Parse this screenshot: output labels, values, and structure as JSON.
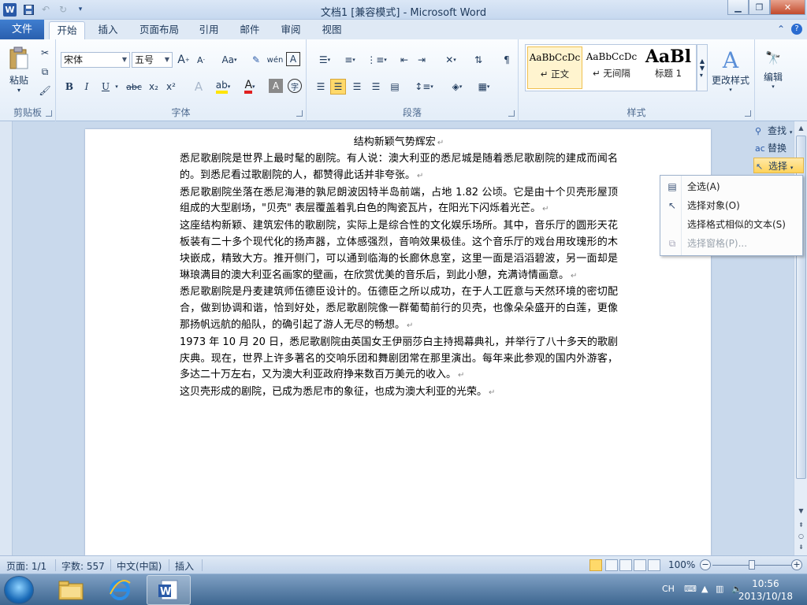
{
  "window": {
    "title": "文档1 [兼容模式] - Microsoft Word",
    "app_logo": "W",
    "controls": [
      "minimize-icon",
      "restore-icon",
      "close-icon"
    ]
  },
  "ribbon_tabs": [
    "文件",
    "开始",
    "插入",
    "页面布局",
    "引用",
    "邮件",
    "审阅",
    "视图"
  ],
  "clipboard": {
    "paste_label": "粘贴",
    "group_label": "剪贴板"
  },
  "font": {
    "name": "宋体",
    "size": "五号",
    "group_label": "字体",
    "bold": "B",
    "italic": "I",
    "underline": "U",
    "strike": "abc",
    "subscript": "x₂",
    "superscript": "x²",
    "change_case": "Aa",
    "grow": "A",
    "shrink": "A",
    "char_border": "A",
    "enclose": "字"
  },
  "paragraph": {
    "group_label": "段落"
  },
  "styles": {
    "group_label": "样式",
    "items": [
      {
        "sample": "AaBbCcDc",
        "name": "↵ 正文"
      },
      {
        "sample": "AaBbCcDc",
        "name": "↵ 无间隔"
      },
      {
        "sample": "AaBl",
        "name": "标题 1"
      }
    ],
    "change_styles_label": "更改样式"
  },
  "editing": {
    "group_label": "编辑",
    "find_label": "查找",
    "replace_label": "替换",
    "select_label": "选择"
  },
  "select_menu": {
    "items": [
      {
        "label": "全选(A)",
        "disabled": false
      },
      {
        "label": "选择对象(O)",
        "disabled": false
      },
      {
        "label": "选择格式相似的文本(S)",
        "disabled": false
      },
      {
        "label": "选择窗格(P)...",
        "disabled": true
      }
    ]
  },
  "document": {
    "title": "结构新颖气势辉宏",
    "paragraphs": [
      "悉尼歌剧院是世界上最时髦的剧院。有人说：澳大利亚的悉尼城是随着悉尼歌剧院的建成而闻名的。到悉尼看过歌剧院的人，都赞得此话并非夸张。",
      "悉尼歌剧院坐落在悉尼海港的孰尼朗波因特半岛前端，占地 1.82 公顷。它是由十个贝壳形屋顶组成的大型剧场，\"贝壳\" 表层覆盖着乳白色的陶瓷瓦片，在阳光下闪烁着光芒。",
      "这座结构新颖、建筑宏伟的歌剧院，实际上是综合性的文化娱乐场所。其中，音乐厅的圆形天花板装有二十多个现代化的扬声器，立体感强烈，音响效果极佳。这个音乐厅的戏台用玫瑰形的木块嵌成，精致大方。推开侧门，可以通到临海的长廊休息室，这里一面是滔滔碧波，另一面却是琳琅满目的澳大利亚名画家的壁画，在欣赏优美的音乐后，到此小憩，充满诗情画意。",
      "悉尼歌剧院是丹麦建筑师伍德臣设计的。伍德臣之所以成功，在于人工匠意与天然环境的密切配合，做到协调和谐，恰到好处，悉尼歌剧院像一群葡萄前行的贝壳，也像朵朵盛开的白莲，更像那扬帆远航的船队，的确引起了游人无尽的畅想。",
      "1973 年 10 月 20 日，悉尼歌剧院由英国女王伊丽莎白主持揭幕典礼，并举行了八十多天的歌剧庆典。现在，世界上许多著名的交响乐团和舞剧团常在那里演出。每年来此参观的国内外游客，多达二十万左右，又为澳大利亚政府挣来数百万美元的收入。",
      "这贝壳形成的剧院，已成为悉尼市的象征，也成为澳大利亚的光荣。"
    ],
    "para_mark": "↵"
  },
  "statusbar": {
    "page": "页面: 1/1",
    "words": "字数: 557",
    "language": "中文(中国)",
    "mode": "插入",
    "zoom": "100%",
    "zoom_fraction": 0.5
  },
  "taskbar": {
    "time": "10:56",
    "date": "2013/10/18",
    "ime": "CH",
    "apps": [
      "folder-icon",
      "ie-icon",
      "word-icon"
    ]
  }
}
